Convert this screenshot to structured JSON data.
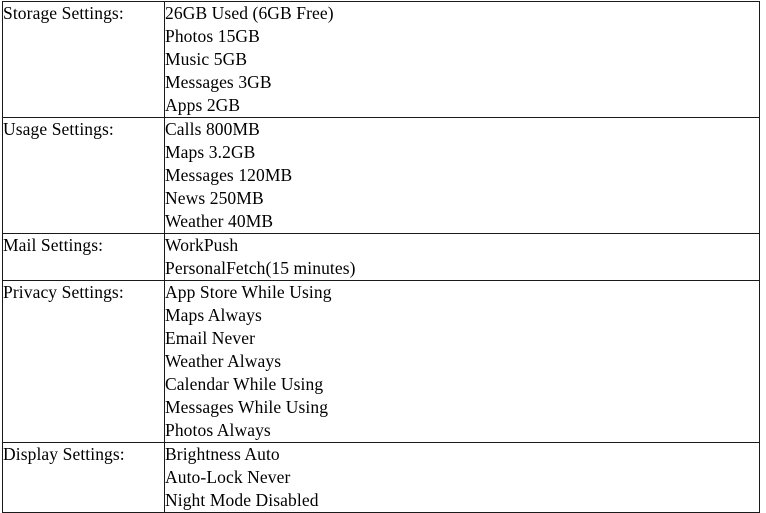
{
  "document": {
    "type": "settings-summary-table",
    "columns": 2,
    "row_count": 5
  },
  "table": {
    "rows": [
      {
        "label": "Storage Settings:",
        "values": [
          "26GB Used (6GB Free)",
          "Photos 15GB",
          "Music 5GB",
          "Messages 3GB",
          "Apps 2GB"
        ]
      },
      {
        "label": "Usage Settings:",
        "values": [
          "Calls 800MB",
          "Maps 3.2GB",
          "Messages 120MB",
          "News 250MB",
          "Weather 40MB"
        ]
      },
      {
        "label": "Mail Settings:",
        "values": [
          "WorkPush",
          "PersonalFetch(15 minutes)"
        ]
      },
      {
        "label": "Privacy Settings:",
        "values": [
          "App Store While Using",
          "Maps Always",
          "Email Never",
          "Weather Always",
          "Calendar While Using",
          "Messages While Using",
          "Photos Always"
        ]
      },
      {
        "label": "Display Settings:",
        "values": [
          "Brightness Auto",
          "Auto-Lock Never",
          "Night Mode Disabled"
        ]
      }
    ]
  },
  "colors": {
    "text": "#000000",
    "border": "#1a1a1a",
    "background": "#ffffff"
  }
}
